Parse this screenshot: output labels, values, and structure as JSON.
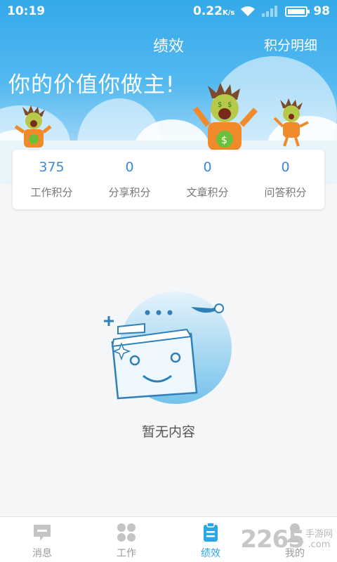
{
  "status_bar": {
    "time": "10:19",
    "speed": "0.22",
    "speed_unit": "K/s",
    "battery": "98"
  },
  "header": {
    "title": "绩效",
    "right_link": "积分明细",
    "slogan": "你的价值你做主!"
  },
  "stats": [
    {
      "value": "375",
      "label": "工作积分"
    },
    {
      "value": "0",
      "label": "分享积分"
    },
    {
      "value": "0",
      "label": "文章积分"
    },
    {
      "value": "0",
      "label": "问答积分"
    }
  ],
  "empty_state": {
    "text": "暂无内容"
  },
  "bottom_nav": [
    {
      "label": "消息",
      "icon": "message-icon",
      "active": false
    },
    {
      "label": "工作",
      "icon": "grid-icon",
      "active": false
    },
    {
      "label": "绩效",
      "icon": "clipboard-icon",
      "active": true
    },
    {
      "label": "我的",
      "icon": "user-icon",
      "active": false
    }
  ],
  "watermark": {
    "number": "2265",
    "line1": "手游网",
    "line2": ".com"
  },
  "colors": {
    "primary": "#2aa6e8",
    "stat_value": "#3a8ad6",
    "inactive": "#9a9a9a"
  }
}
